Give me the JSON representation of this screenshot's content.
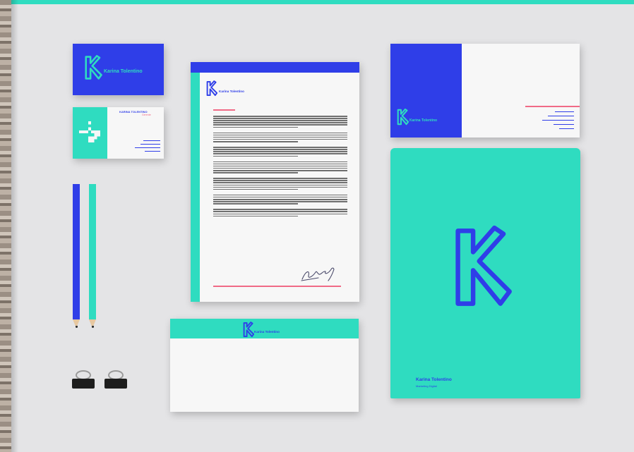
{
  "colors": {
    "blue": "#2f3ee8",
    "teal": "#2fdcc0",
    "pink": "#f06a86",
    "paper": "#f7f7f7",
    "surface": "#e4e4e6"
  },
  "brand": {
    "initial": "K",
    "name": "Karina Tolentino",
    "tagline": "Marketing Digital"
  },
  "business_card": {
    "person_name": "KARINA TOLENTINO",
    "role": "Gerente"
  },
  "icons": {
    "logo": "k-logo-icon",
    "signature": "signature-icon",
    "qr": "qr-code-icon"
  }
}
